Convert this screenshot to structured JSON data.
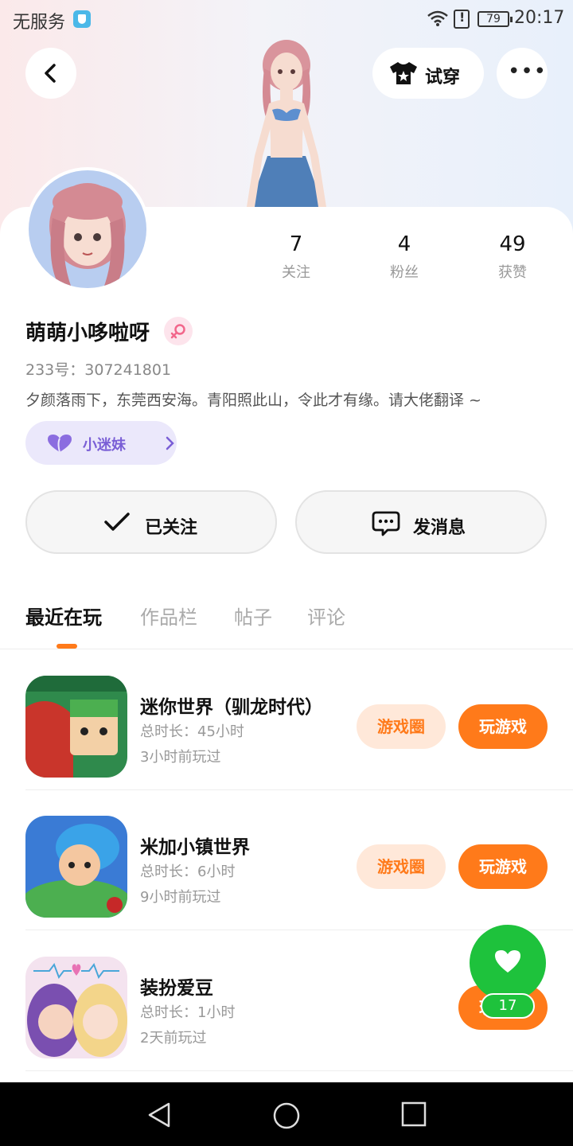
{
  "status_bar": {
    "carrier": "无服务",
    "battery": "79",
    "time": "20:17"
  },
  "header": {
    "tryon_label": "试穿"
  },
  "profile": {
    "stats": [
      {
        "value": "7",
        "label": "关注"
      },
      {
        "value": "4",
        "label": "粉丝"
      },
      {
        "value": "49",
        "label": "获赞"
      }
    ],
    "username": "萌萌小哆啦呀",
    "uid": "233号：307241801",
    "bio": "夕颜落雨下，东莞西安海。青阳照此山，令此才有缘。请大佬翻译 ~",
    "badge": "小迷妹"
  },
  "actions": {
    "follow": "已关注",
    "message": "发消息"
  },
  "tabs": [
    "最近在玩",
    "作品栏",
    "帖子",
    "评论"
  ],
  "games": [
    {
      "name": "迷你世界（驯龙时代）",
      "duration": "总时长：45小时",
      "last_played": "3小时前玩过",
      "circle": "游戏圈",
      "play": "玩游戏"
    },
    {
      "name": "米加小镇世界",
      "duration": "总时长：6小时",
      "last_played": "9小时前玩过",
      "circle": "游戏圈",
      "play": "玩游戏"
    },
    {
      "name": "装扮爱豆",
      "duration": "总时长：1小时",
      "last_played": "2天前玩过",
      "circle": "",
      "play": "玩游戏"
    }
  ],
  "fab": {
    "count": "17"
  },
  "colors": {
    "accent": "#ff7a1a",
    "fab": "#1ec23c",
    "badge": "#7a5fd6"
  }
}
